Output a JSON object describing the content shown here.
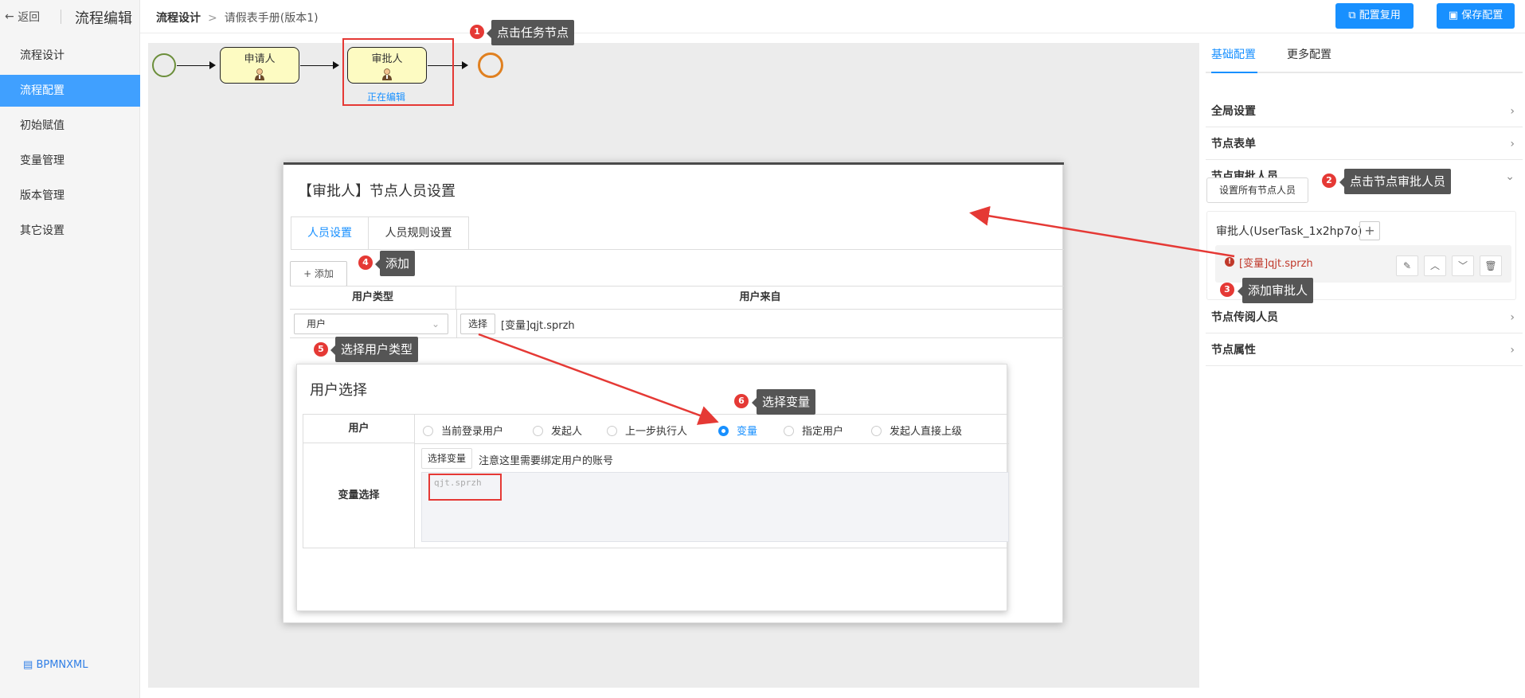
{
  "sidebar": {
    "back_label": "返回",
    "title": "流程编辑",
    "items": [
      {
        "label": "流程设计"
      },
      {
        "label": "流程配置"
      },
      {
        "label": "初始赋值"
      },
      {
        "label": "变量管理"
      },
      {
        "label": "版本管理"
      },
      {
        "label": "其它设置"
      }
    ],
    "active_index": 1,
    "bpmn_link": "BPMNXML"
  },
  "topbar": {
    "breadcrumb_root": "流程设计",
    "breadcrumb_sep": ">",
    "breadcrumb_current": "请假表手册(版本1)",
    "btn_reuse": "配置复用",
    "btn_save": "保存配置"
  },
  "diagram": {
    "nodes": [
      {
        "label": "申请人"
      },
      {
        "label": "审批人",
        "status": "正在编辑"
      }
    ]
  },
  "right_panel": {
    "tabs": [
      "基础配置",
      "更多配置"
    ],
    "active_tab": 0,
    "sections": {
      "global": "全局设置",
      "form": "节点表单",
      "approvers": "节点审批人员",
      "cc": "节点传阅人员",
      "props": "节点属性"
    },
    "set_all_btn": "设置所有节点人员",
    "approver_title": "审批人(UserTask_1x2hp7o)",
    "approver_entry": "[变量]qjt.sprzh"
  },
  "modal_person": {
    "title": "【审批人】节点人员设置",
    "tabs": [
      "人员设置",
      "人员规则设置"
    ],
    "add_btn": "+ 添加",
    "col_user_type": "用户类型",
    "col_user_from": "用户来自",
    "row_user_type": "用户",
    "pick_btn": "选择",
    "row_from": "[变量]qjt.sprzh"
  },
  "modal_user_select": {
    "title": "用户选择",
    "row_user": "用户",
    "row_var": "变量选择",
    "radios": [
      "当前登录用户",
      "发起人",
      "上一步执行人",
      "变量",
      "指定用户",
      "发起人直接上级"
    ],
    "selected_radio": 3,
    "pick_var_btn": "选择变量",
    "note": "注意这里需要绑定用户的账号",
    "textarea_value": "qjt.sprzh"
  },
  "callouts": [
    {
      "num": "1",
      "text": "点击任务节点"
    },
    {
      "num": "2",
      "text": "点击节点审批人员"
    },
    {
      "num": "3",
      "text": "添加审批人"
    },
    {
      "num": "4",
      "text": "添加"
    },
    {
      "num": "5",
      "text": "选择用户类型"
    },
    {
      "num": "6",
      "text": "选择变量"
    }
  ],
  "colors": {
    "accent": "#1890ff",
    "sidebar_active": "#40a0ff",
    "annotation_red": "#e53935",
    "task_fill": "#fdfbc2",
    "start_event": "#6b8e3a",
    "end_event": "#e08020"
  }
}
